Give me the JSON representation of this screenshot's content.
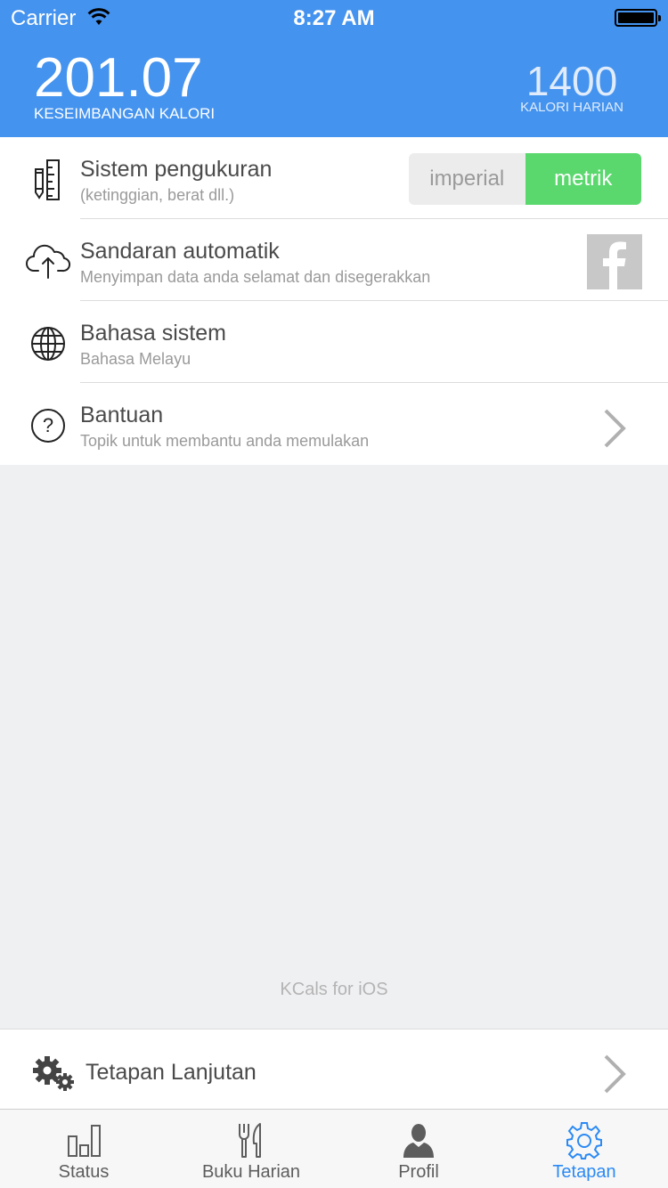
{
  "status_bar": {
    "carrier": "Carrier",
    "time": "8:27 AM"
  },
  "header": {
    "balance_value": "201.07",
    "balance_label": "KESEIMBANGAN KALORI",
    "daily_value": "1400",
    "daily_label": "KALORI HARIAN"
  },
  "settings": [
    {
      "title": "Sistem pengukuran",
      "subtitle": "(ketinggian, berat dll.)",
      "icon": "ruler-pencil-icon"
    },
    {
      "title": "Sandaran automatik",
      "subtitle": "Menyimpan data anda selamat dan disegerakkan",
      "icon": "cloud-upload-icon"
    },
    {
      "title": "Bahasa sistem",
      "subtitle": "Bahasa Melayu",
      "icon": "globe-icon"
    },
    {
      "title": "Bantuan",
      "subtitle": "Topik untuk membantu anda memulakan",
      "icon": "question-icon"
    }
  ],
  "units_toggle": {
    "options": [
      "imperial",
      "metrik"
    ],
    "selected": "metrik"
  },
  "footer_text": "KCals for iOS",
  "advanced": {
    "title": "Tetapan Lanjutan"
  },
  "tabs": [
    {
      "label": "Status",
      "icon": "bar-chart-icon"
    },
    {
      "label": "Buku Harian",
      "icon": "fork-knife-icon"
    },
    {
      "label": "Profil",
      "icon": "person-icon"
    },
    {
      "label": "Tetapan",
      "icon": "gear-icon",
      "active": true
    }
  ],
  "colors": {
    "header": "#4493ef",
    "accent": "#2b8af4",
    "toggle_on": "#5ad86e"
  }
}
